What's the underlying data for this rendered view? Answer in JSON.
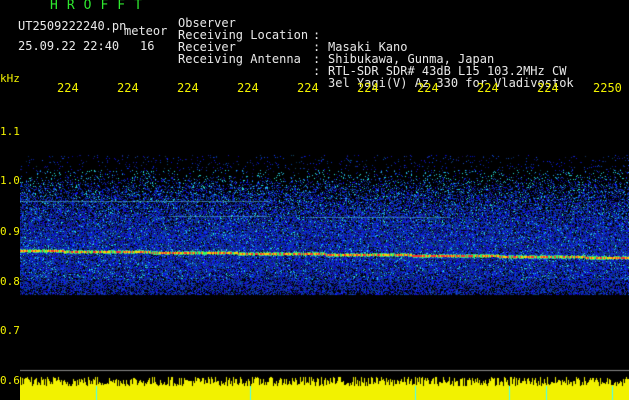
{
  "header": {
    "app_title": "HROFFT",
    "file_name": "UT2509222240.pn",
    "file_type": "meteor",
    "datetime": "25.09.22 22:40",
    "count": "16"
  },
  "meta": [
    {
      "label": "Observer",
      "value": "Masaki Kano"
    },
    {
      "label": "Receiving Location",
      "value": "Shibukawa, Gunma, Japan"
    },
    {
      "label": "Receiver",
      "value": "RTL-SDR SDR# 43dB L15 103.2MHz CW"
    },
    {
      "label": "Receiving Antenna",
      "value": "3el Yagi(V) Az 330 for Vladivostok"
    }
  ],
  "separator": ":",
  "axis": {
    "y_unit": "kHz",
    "x_ticks": [
      "224",
      "224",
      "224",
      "224",
      "224",
      "224",
      "224",
      "224",
      "224",
      "2250"
    ],
    "y_ticks": [
      "1.1",
      "1.0",
      "0.9",
      "0.8",
      "0.7",
      "0.6"
    ]
  },
  "colors": {
    "background": "#000000",
    "title": "#2ee82e",
    "text": "#e8e8e8",
    "axis": "#f2f200",
    "noise_band": "#1a3fd0",
    "signal_line": "#ff3030",
    "bottom_band": "#f2f200"
  }
}
